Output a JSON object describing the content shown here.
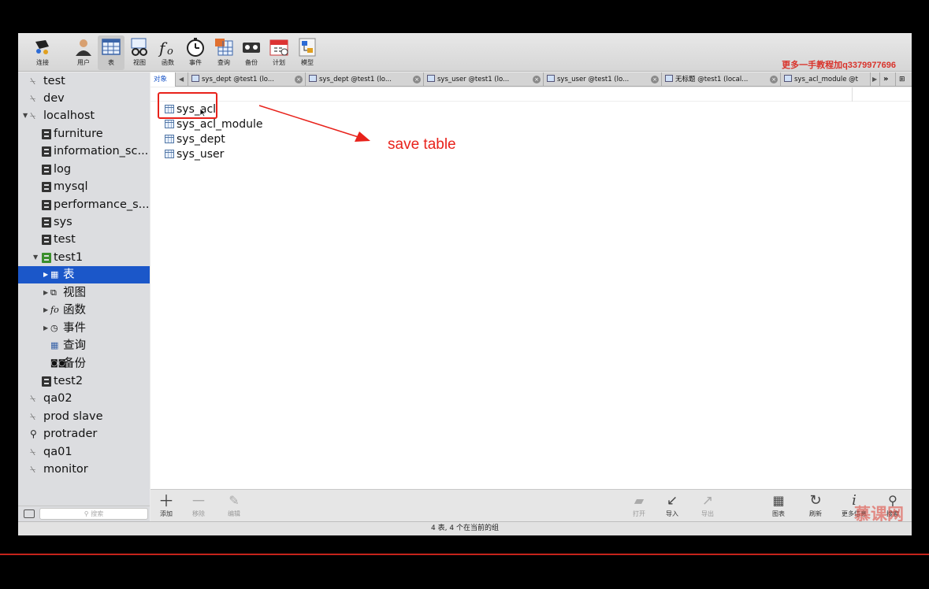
{
  "colors": {
    "selection": "#1b57c9",
    "annotation": "#e8221b",
    "watermark": "#d9332b"
  },
  "toolbar": {
    "items": [
      {
        "label": "连接",
        "icon": "connection-icon"
      },
      {
        "label": "用户",
        "icon": "user-icon"
      },
      {
        "label": "表",
        "icon": "table-icon"
      },
      {
        "label": "视图",
        "icon": "view-icon"
      },
      {
        "label": "函数",
        "icon": "function-icon"
      },
      {
        "label": "事件",
        "icon": "event-clock-icon"
      },
      {
        "label": "查询",
        "icon": "query-icon"
      },
      {
        "label": "备份",
        "icon": "backup-icon"
      },
      {
        "label": "计划",
        "icon": "schedule-icon"
      },
      {
        "label": "模型",
        "icon": "model-icon"
      }
    ],
    "watermark": "更多一手教程加q3379977696"
  },
  "sidebar": {
    "items": [
      {
        "label": "test",
        "kind": "connection"
      },
      {
        "label": "dev",
        "kind": "connection"
      },
      {
        "label": "localhost",
        "kind": "connection"
      },
      {
        "label": "furniture",
        "kind": "database"
      },
      {
        "label": "information_sc...",
        "kind": "database"
      },
      {
        "label": "log",
        "kind": "database"
      },
      {
        "label": "mysql",
        "kind": "database"
      },
      {
        "label": "performance_s...",
        "kind": "database"
      },
      {
        "label": "sys",
        "kind": "database"
      },
      {
        "label": "test",
        "kind": "database"
      },
      {
        "label": "test1",
        "kind": "database"
      },
      {
        "label": "表",
        "kind": "tables"
      },
      {
        "label": "视图",
        "kind": "views"
      },
      {
        "label": "函数",
        "kind": "functions"
      },
      {
        "label": "事件",
        "kind": "events"
      },
      {
        "label": "查询",
        "kind": "queries"
      },
      {
        "label": "备份",
        "kind": "backups"
      },
      {
        "label": "test2",
        "kind": "database"
      },
      {
        "label": "qa02",
        "kind": "connection"
      },
      {
        "label": "prod slave",
        "kind": "connection"
      },
      {
        "label": "protrader",
        "kind": "connection"
      },
      {
        "label": "qa01",
        "kind": "connection"
      },
      {
        "label": "monitor",
        "kind": "connection"
      }
    ],
    "search_placeholder": "搜索"
  },
  "tabs": [
    {
      "label": "对象"
    },
    {
      "label": "sys_dept @test1 (lo..."
    },
    {
      "label": "sys_dept @test1 (lo..."
    },
    {
      "label": "sys_user @test1 (lo..."
    },
    {
      "label": "sys_user @test1 (lo..."
    },
    {
      "label": "无标题 @test1 (local..."
    },
    {
      "label": "sys_acl_module @t"
    }
  ],
  "objects": [
    "sys_acl",
    "sys_acl_module",
    "sys_dept",
    "sys_user"
  ],
  "annotation": "save table",
  "bottombar": {
    "left": [
      {
        "label": "添加",
        "icon": "plus-icon"
      },
      {
        "label": "移除",
        "icon": "minus-icon"
      },
      {
        "label": "编辑",
        "icon": "pencil-icon"
      }
    ],
    "right": [
      {
        "label": "打开",
        "icon": "open-folder-icon"
      },
      {
        "label": "导入",
        "icon": "import-icon"
      },
      {
        "label": "导出",
        "icon": "export-icon"
      },
      {
        "label": "图表",
        "icon": "chart-icon"
      },
      {
        "label": "刷新",
        "icon": "refresh-icon"
      },
      {
        "label": "更多信息",
        "icon": "info-icon"
      },
      {
        "label": "搜索",
        "icon": "search-icon"
      }
    ],
    "watermark": "慕课网"
  },
  "status": "4 表, 4 个在当前的组"
}
